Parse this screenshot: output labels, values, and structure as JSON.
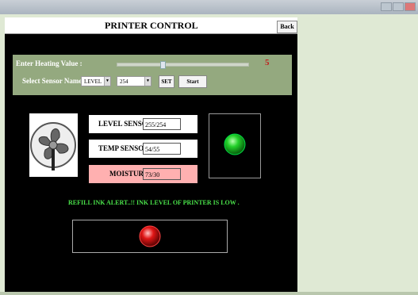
{
  "window": {
    "title": "PRINTER CONTROL",
    "back_label": "Back"
  },
  "panel": {
    "heating_label": "Enter Heating Value :",
    "heating_value": "5",
    "heating_slider_fraction": 0.34,
    "sensor_label": "Select Sensor Name",
    "sensor_select": "LEVEL",
    "threshold_select": "254",
    "set_label": "SET",
    "start_label": "Start"
  },
  "sensors": {
    "level": {
      "label": "LEVEL SENSOR",
      "value": "255/254"
    },
    "temp": {
      "label": "TEMP SENSOR",
      "value": "54/55"
    },
    "moisture": {
      "label": "MOISTURE",
      "value": "73/30"
    }
  },
  "alert": {
    "text": "REFILL INK ALERT..!! INK LEVEL OF PRINTER IS LOW ."
  },
  "indicators": {
    "status_color": "#23d12a",
    "alert_color": "#e01616"
  },
  "colors": {
    "panel": "#94a97f",
    "value_red": "#c21b1b",
    "pink": "#ffb0b0",
    "alert_green": "#49e049"
  },
  "icons": {
    "fan": "fan-icon"
  }
}
